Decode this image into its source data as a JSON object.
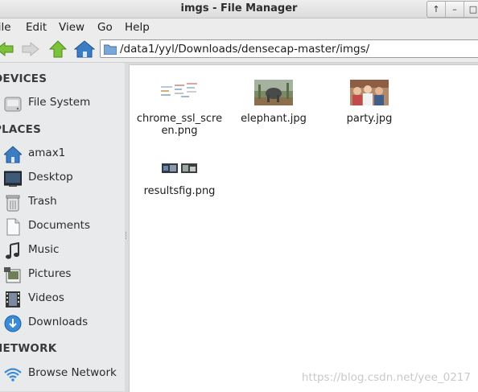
{
  "window": {
    "title": "imgs - File Manager"
  },
  "menu": {
    "file": "File",
    "edit": "Edit",
    "view": "View",
    "go": "Go",
    "help": "Help"
  },
  "location": {
    "path": "/data1/yyl/Downloads/densecap-master/imgs/"
  },
  "sidebar": {
    "devices_header": "DEVICES",
    "devices": [
      {
        "label": "File System",
        "icon": "drive-icon"
      }
    ],
    "places_header": "PLACES",
    "places": [
      {
        "label": "amax1",
        "icon": "home-icon"
      },
      {
        "label": "Desktop",
        "icon": "desktop-icon"
      },
      {
        "label": "Trash",
        "icon": "trash-icon"
      },
      {
        "label": "Documents",
        "icon": "document-icon"
      },
      {
        "label": "Music",
        "icon": "music-icon"
      },
      {
        "label": "Pictures",
        "icon": "pictures-icon"
      },
      {
        "label": "Videos",
        "icon": "videos-icon"
      },
      {
        "label": "Downloads",
        "icon": "downloads-icon"
      }
    ],
    "network_header": "NETWORK",
    "network": [
      {
        "label": "Browse Network",
        "icon": "network-icon"
      }
    ]
  },
  "files": [
    {
      "name": "chrome_ssl_scre en.png"
    },
    {
      "name": "elephant.jpg"
    },
    {
      "name": "party.jpg"
    },
    {
      "name": "resultsfig.png"
    }
  ],
  "watermark": "https://blog.csdn.net/yee_0217",
  "colors": {
    "accent_blue": "#3b7dc4",
    "arrow_green": "#6cbd2c"
  }
}
